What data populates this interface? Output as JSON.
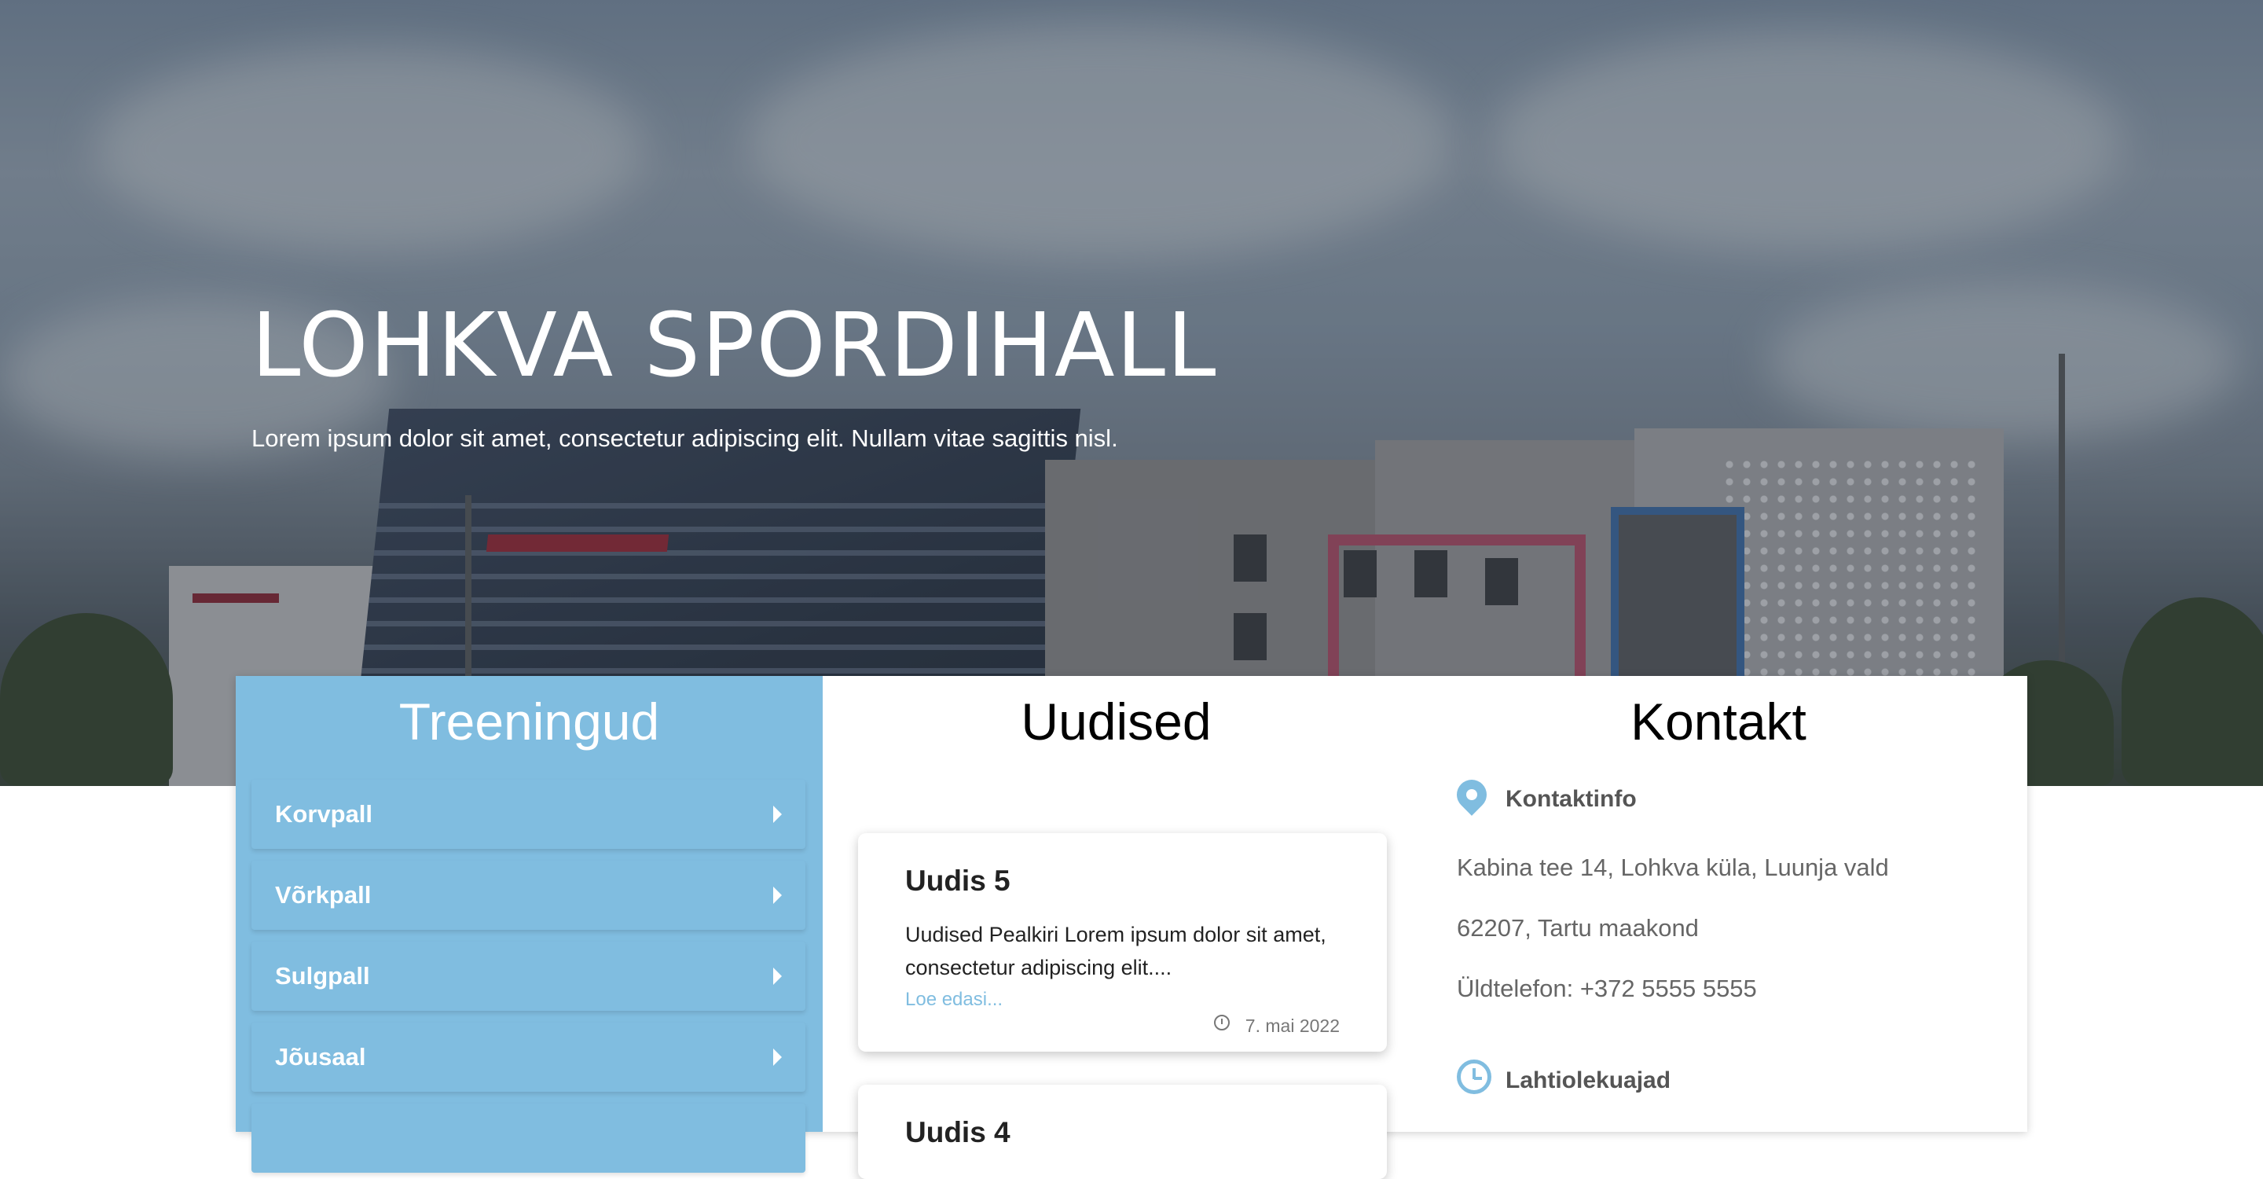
{
  "hero": {
    "title": "LOHKVA SPORDIHALL",
    "subtitle": "Lorem ipsum dolor sit amet, consectetur adipiscing elit. Nullam vitae sagittis nisl."
  },
  "trainings": {
    "heading": "Treeningud",
    "items": [
      {
        "label": "Korvpall",
        "icon": "chevron-right-icon"
      },
      {
        "label": "Võrkpall",
        "icon": "chevron-right-icon"
      },
      {
        "label": "Sulgpall",
        "icon": "chevron-right-icon"
      },
      {
        "label": "Jõusaal",
        "icon": "chevron-right-icon"
      }
    ]
  },
  "news": {
    "heading": "Uudised",
    "items": [
      {
        "title": "Uudis 5",
        "text": "Uudised Pealkiri Lorem ipsum dolor sit amet, consectetur adipiscing elit....",
        "more": "Loe edasi...",
        "date": "7. mai 2022"
      },
      {
        "title": "Uudis 4"
      }
    ]
  },
  "contact": {
    "heading": "Kontakt",
    "info_title": "Kontaktinfo",
    "address_line1": "Kabina tee 14, Lohkva küla, Luunja vald",
    "address_line2": "62207, Tartu maakond",
    "phone": "Üldtelefon: +372 5555 5555",
    "hours_title": "Lahtiolekuajad"
  },
  "colors": {
    "accent": "#80bde0",
    "text": "#222222",
    "muted": "#666666"
  }
}
